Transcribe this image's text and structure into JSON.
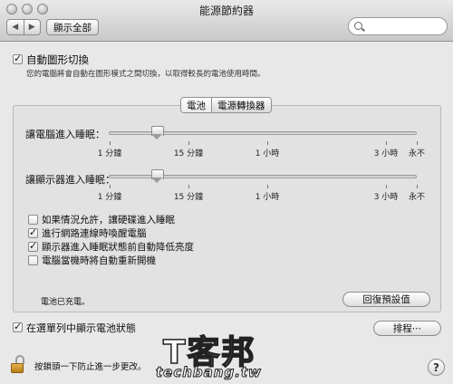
{
  "window": {
    "title": "能源節約器"
  },
  "toolbar": {
    "back_label": "◀",
    "forward_label": "▶",
    "show_all_label": "顯示全部",
    "search_placeholder": ""
  },
  "auto_switch": {
    "label": "自動圖形切換",
    "checked": true,
    "description": "您的電腦將會自動在圖形模式之間切換，以取得較長的電池使用時間。"
  },
  "tabs": [
    {
      "label": "電池",
      "selected": true
    },
    {
      "label": "電源轉換器",
      "selected": false
    }
  ],
  "computer_sleep": {
    "label": "讓電腦進入睡眠：",
    "value_fraction": 0.155,
    "tick_labels": [
      "1 分鐘",
      "15 分鐘",
      "1 小時",
      "3 小時",
      "永不"
    ]
  },
  "display_sleep": {
    "label": "讓顯示器進入睡眠：",
    "value_fraction": 0.155,
    "tick_labels": [
      "1 分鐘",
      "15 分鐘",
      "1 小時",
      "3 小時",
      "永不"
    ]
  },
  "options": [
    {
      "label": "如果情況允許，讓硬碟進入睡眠",
      "checked": false
    },
    {
      "label": "進行網路連線時喚醒電腦",
      "checked": true
    },
    {
      "label": "顯示器進入睡眠狀態前自動降低亮度",
      "checked": true
    },
    {
      "label": "電腦當機時將自動重新開機",
      "checked": false
    }
  ],
  "battery_status": "電池已充電。",
  "restore_defaults_label": "回復預設值",
  "menu_bar_status": {
    "label": "在選單列中顯示電池狀態",
    "checked": true
  },
  "schedule_label": "排程⋯",
  "lock_text": "按鎖頭一下防止進一步更改。",
  "help_label": "?",
  "watermark": {
    "big": "T客邦",
    "small": "techbang.tw"
  }
}
